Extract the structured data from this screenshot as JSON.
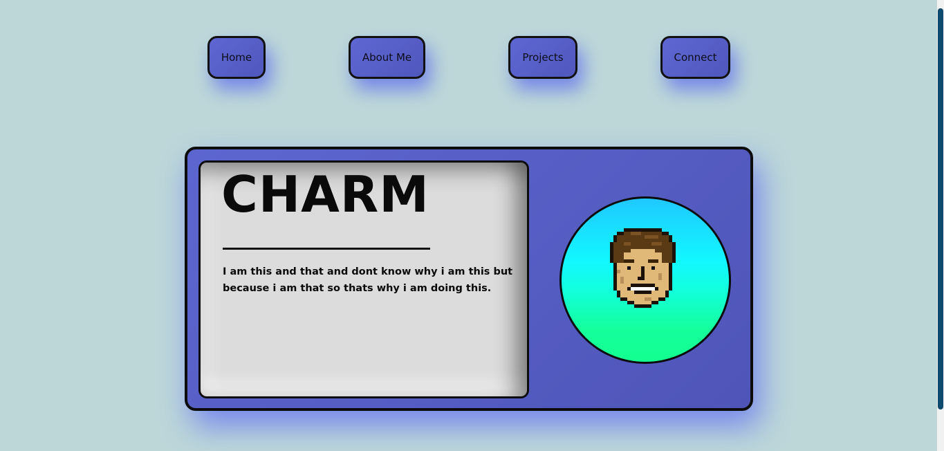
{
  "nav": {
    "items": [
      {
        "label": "Home"
      },
      {
        "label": "About Me"
      },
      {
        "label": "Projects"
      },
      {
        "label": "Connect"
      }
    ]
  },
  "hero": {
    "title": "CHARM",
    "bio": "I am this and that and dont know why i am this but because i am that so thats why i am doing this."
  },
  "avatar": {
    "icon": "pixel-face-avatar"
  },
  "colors": {
    "background": "#bdd7d9",
    "button": "#5a62cc",
    "card": "#565ec6",
    "panel": "#dcdcdc",
    "scrollbar": "#0e4a6e"
  }
}
